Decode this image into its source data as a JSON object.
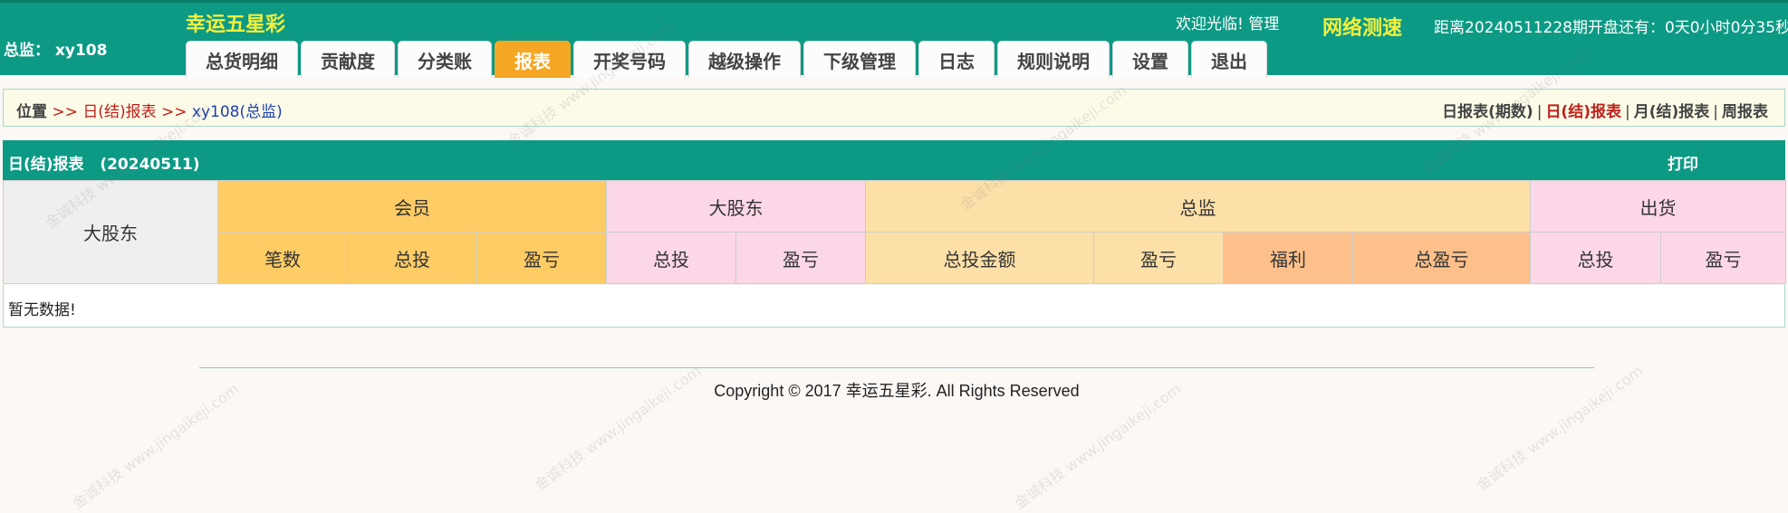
{
  "header": {
    "brand": "幸运五星彩",
    "user_label": "总监： xy108",
    "welcome": "欢迎光临! 管理",
    "speedtest": "网络测速",
    "countdown": "距离20240511228期开盘还有：0天0小时0分35秒"
  },
  "nav": {
    "tabs": [
      {
        "label": "总货明细",
        "active": false
      },
      {
        "label": "贡献度",
        "active": false
      },
      {
        "label": "分类账",
        "active": false
      },
      {
        "label": "报表",
        "active": true
      },
      {
        "label": "开奖号码",
        "active": false
      },
      {
        "label": "越级操作",
        "active": false
      },
      {
        "label": "下级管理",
        "active": false
      },
      {
        "label": "日志",
        "active": false
      },
      {
        "label": "规则说明",
        "active": false
      },
      {
        "label": "设置",
        "active": false
      },
      {
        "label": "退出",
        "active": false
      }
    ]
  },
  "breadcrumb": {
    "position": "位置",
    "arrow": ">>",
    "level1": "日(结)报表",
    "level2": "xy108(总监)"
  },
  "report_links": [
    {
      "label": "日报表(期数)",
      "active": false
    },
    {
      "label": "日(结)报表",
      "active": true
    },
    {
      "label": "月(结)报表",
      "active": false
    },
    {
      "label": "周报表",
      "active": false
    }
  ],
  "report_links_separator": "|",
  "report": {
    "title": "日(结)报表",
    "date": "(20240511)",
    "print": "打印",
    "row_header": "大股东",
    "groups": [
      {
        "label": "会员",
        "color": "#fdcc65"
      },
      {
        "label": "大股东",
        "color": "#fcd7e8"
      },
      {
        "label": "总监",
        "color": "#fde0a8"
      },
      {
        "label": "出货",
        "color": "#fcd7e8"
      }
    ],
    "columns": {
      "member": [
        "笔数",
        "总投",
        "盈亏"
      ],
      "shareholder": [
        "总投",
        "盈亏"
      ],
      "director": [
        "总投金额",
        "盈亏",
        "福利",
        "总盈亏"
      ],
      "shipment": [
        "总投",
        "盈亏"
      ]
    },
    "empty_text": "暂无数据!"
  },
  "footer": {
    "copyright": "Copyright © 2017 幸运五星彩. All Rights Reserved"
  },
  "watermark": "金诚科技 www.jingaikeji.com"
}
